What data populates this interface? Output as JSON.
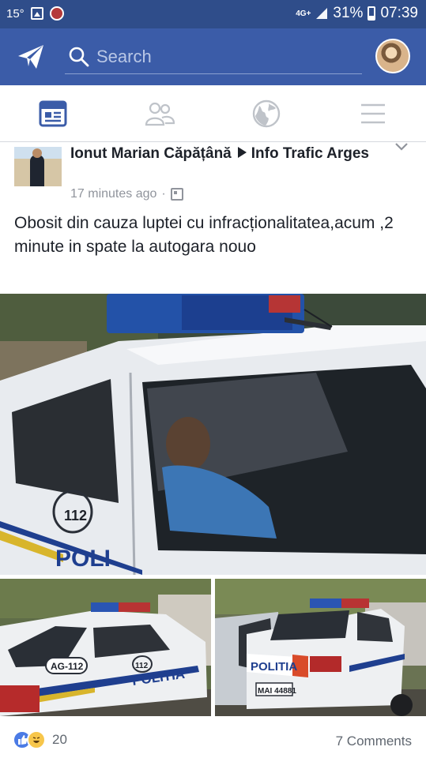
{
  "statusbar": {
    "temperature": "15°",
    "network": "4G+",
    "battery": "31%",
    "time": "07:39"
  },
  "header": {
    "search_placeholder": "Search"
  },
  "tabs": [
    {
      "icon": "news-feed-icon",
      "active": true
    },
    {
      "icon": "friends-icon",
      "active": false
    },
    {
      "icon": "globe-icon",
      "active": false
    },
    {
      "icon": "menu-icon",
      "active": false
    }
  ],
  "post": {
    "author": "Ionut Marian Căpățână",
    "group": "Info Trafic Arges",
    "time": "17 minutes ago",
    "separator": "·",
    "text": "Obosit din cauza luptei cu infracționalitatea,acum ,2 minute in spate la autogara nouo",
    "photos": {
      "left_plate": "AG-112",
      "left_door_number": "112",
      "left_side_text": "POLITIA",
      "right_side_text": "POLITIA",
      "right_plate": "MAI 44881",
      "main_door_number": "112",
      "main_side_text": "POLI"
    },
    "reactions": {
      "count": "20",
      "types": [
        "like",
        "haha"
      ]
    },
    "comments": "7 Comments"
  },
  "colors": {
    "statusbar": "#2f4d8a",
    "header": "#3b5ca8",
    "active_tab": "#3b5ca8",
    "inactive_tab": "#bfc3c9"
  }
}
